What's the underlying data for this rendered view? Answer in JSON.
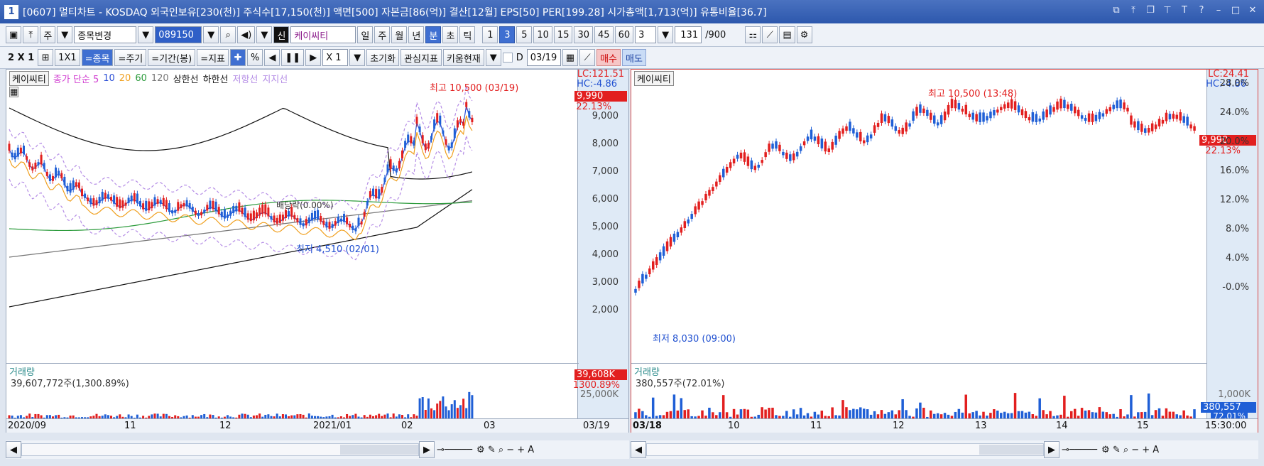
{
  "window": {
    "number": "1",
    "title": "[0607] 멀티차트 - KOSDAQ 외국인보유[230(천)] 주식수[17,150(천)] 액면[500] 자본금[86(억)] 결산[12월] EPS[50] PER[199.28] 시가총액[1,713(억)] 유통비율[36.7]"
  },
  "toolbar1": {
    "jongmok_prefix": "주",
    "jongmok_select": "종목변경",
    "code": "089150",
    "badge": "신",
    "stock_name": "케이씨티",
    "periods": [
      "일",
      "주",
      "월",
      "년",
      "분",
      "초",
      "틱"
    ],
    "active_period": "분",
    "intervals": [
      "1",
      "3",
      "5",
      "10",
      "15",
      "30",
      "45",
      "60"
    ],
    "active_interval": "3",
    "interval_value": "3",
    "count": "131",
    "count_total": "/900"
  },
  "toolbar2": {
    "layout": "2 X 1",
    "one_by_one": "1X1",
    "b_stock": "=종목",
    "b_cycle": "=주기",
    "b_period": "=기간(봉)",
    "b_indicator": "=지표",
    "pct": "%",
    "zoom": "X 1",
    "reset": "초기화",
    "watch": "관심지표",
    "kiwoom": "키움현재",
    "date_prefix": "D",
    "date": "03/19",
    "buy": "매수",
    "sell": "매도"
  },
  "left_chart": {
    "stock": "케이씨티",
    "legend": [
      {
        "t": "종가 단순 5",
        "c": "#d13fd1"
      },
      {
        "t": "10",
        "c": "#2b4fd6"
      },
      {
        "t": "20",
        "c": "#f0a020"
      },
      {
        "t": "60",
        "c": "#2a9a3a"
      },
      {
        "t": "120",
        "c": "#777777"
      },
      {
        "t": "상한선",
        "c": "#111111"
      },
      {
        "t": "하한선",
        "c": "#111111"
      },
      {
        "t": "저항선",
        "c": "#b58de6"
      },
      {
        "t": "지지선",
        "c": "#b58de6"
      }
    ],
    "high_note": "최고 10,500 (03/19)",
    "low_note": "최저 4,510 (02/01)",
    "dividend_note": "배당락(0.00%)",
    "lc": "LC:121.51",
    "hc": "HC:-4.86",
    "price_tag": "9,990",
    "pct_tag": "22.13%",
    "y_ticks": [
      "9,000",
      "8,000",
      "7,000",
      "6,000",
      "5,000",
      "4,000",
      "3,000",
      "2,000"
    ],
    "volume_label": "거래량",
    "volume_value": "39,607,772주(1,300.89%)",
    "volume_tag": "39,608K",
    "volume_pct": "1300.89%",
    "volume_tick": "25,000K",
    "dates": [
      "2020/09",
      "11",
      "12",
      "2021/01",
      "02",
      "03",
      "03/19"
    ]
  },
  "right_chart": {
    "stock": "케이씨티",
    "high_note": "최고 10,500 (13:48)",
    "low_note": "최저 8,030 (09:00)",
    "lc": "LC:24.41",
    "hc": "HC:-4.86",
    "price_tag": "9,990",
    "pct_tag": "22.13%",
    "y_ticks": [
      "28.0%",
      "24.0%",
      "20.0%",
      "16.0%",
      "12.0%",
      "8.0%",
      "4.0%",
      "-0.0%"
    ],
    "volume_label": "거래량",
    "volume_value": "380,557주(72.01%)",
    "volume_tag": "380,557",
    "volume_pct": "72.01%",
    "volume_tick": "1,000K",
    "dates": [
      "03/18",
      "10",
      "11",
      "12",
      "13",
      "14",
      "15",
      "15:30:00"
    ]
  }
}
